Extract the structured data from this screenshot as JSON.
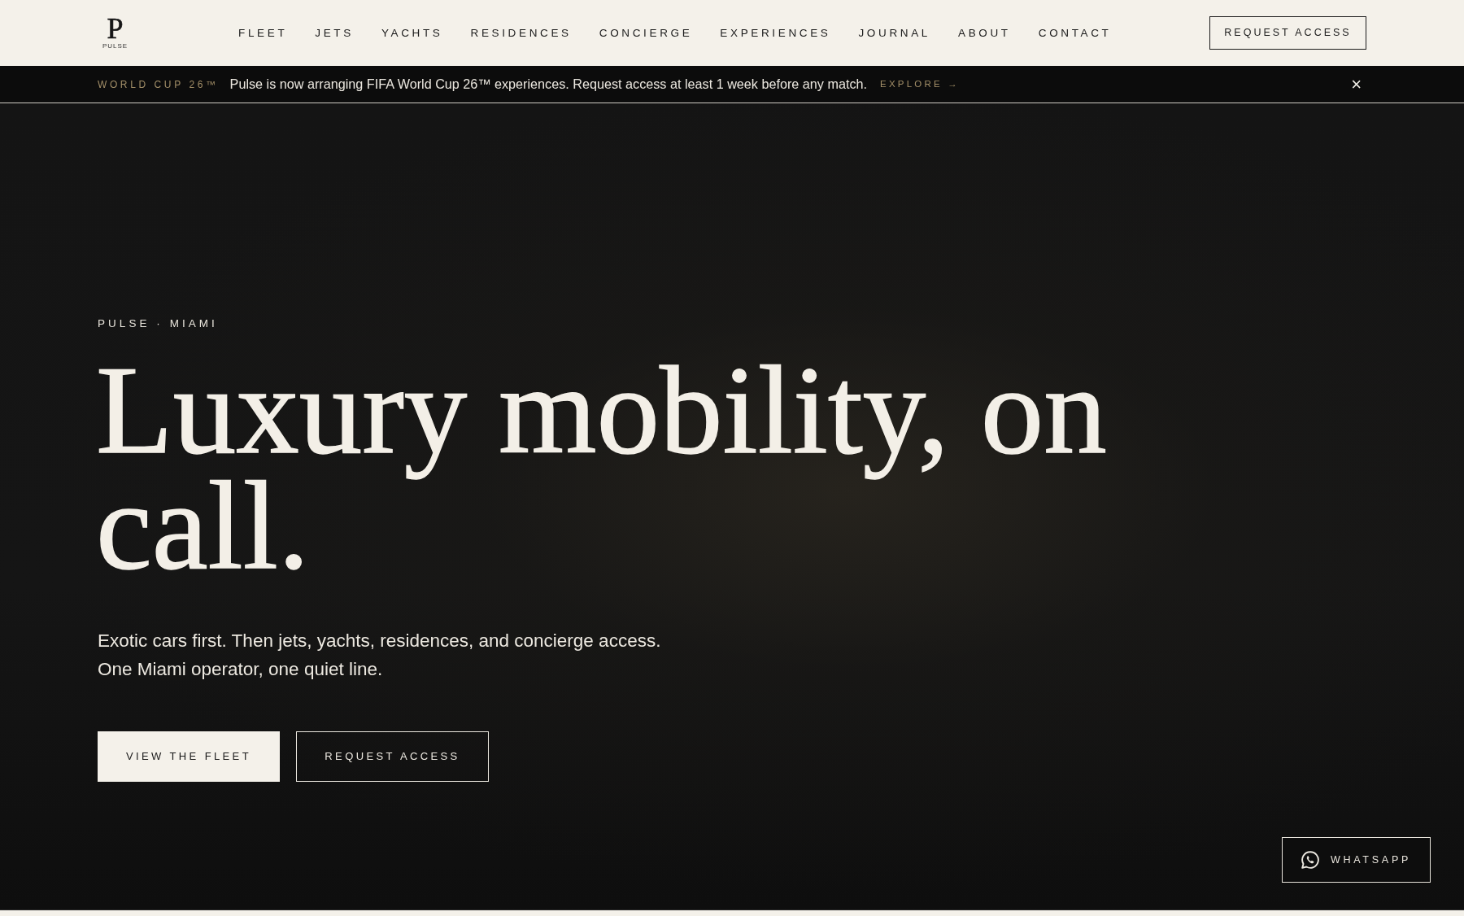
{
  "header": {
    "logo": {
      "letter": "P",
      "wordmark": "PULSE"
    },
    "nav": [
      "FLEET",
      "JETS",
      "YACHTS",
      "RESIDENCES",
      "CONCIERGE",
      "EXPERIENCES",
      "JOURNAL",
      "ABOUT",
      "CONTACT"
    ],
    "cta": "REQUEST ACCESS"
  },
  "announcement": {
    "tag": "WORLD CUP 26™",
    "message": "Pulse is now arranging FIFA World Cup 26™ experiences. Request access at least 1 week before any match.",
    "link": "EXPLORE →",
    "close": "×"
  },
  "hero": {
    "kicker": "PULSE · MIAMI",
    "title": "Luxury mobility, on call.",
    "subtitle_lines": [
      "Exotic cars first. Then jets, yachts, residences, and concierge access.",
      "One Miami operator, one quiet line."
    ],
    "buttons": [
      {
        "label": "VIEW THE FLEET",
        "kind": "primary"
      },
      {
        "label": "REQUEST ACCESS",
        "kind": "outline"
      }
    ]
  },
  "whatsapp": {
    "label": "WHATSAPP"
  }
}
